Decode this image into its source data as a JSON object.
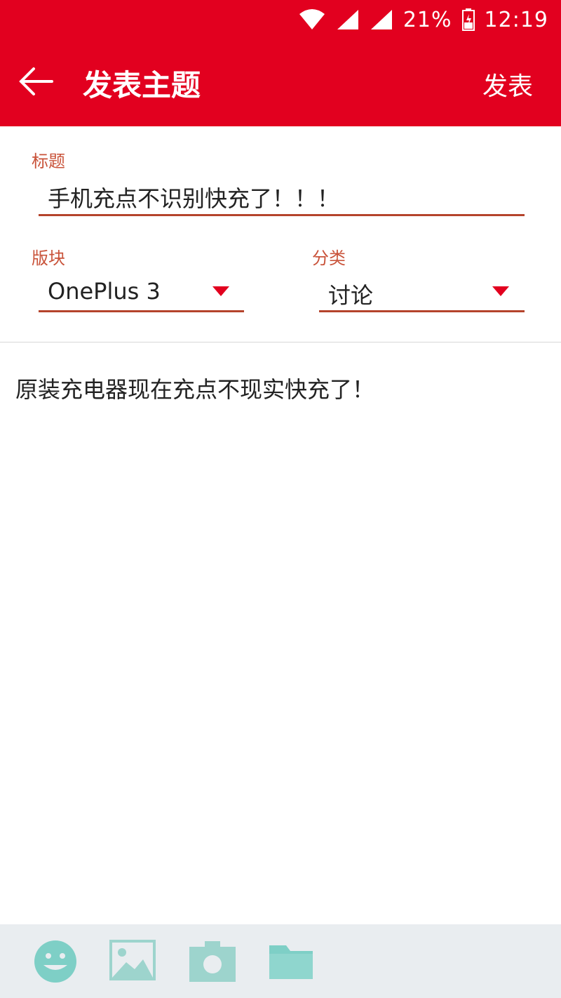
{
  "status_bar": {
    "battery": "21%",
    "time": "12:19",
    "icons": [
      "wifi-icon",
      "signal-icon",
      "signal-icon",
      "battery-icon"
    ]
  },
  "appbar": {
    "title": "发表主题",
    "publish_label": "发表",
    "back_icon": "back-arrow-icon",
    "color": "#e2001f"
  },
  "form": {
    "title_label": "标题",
    "title_value": "手机充点不识别快充了！！！",
    "board_label": "版块",
    "board_value": "OnePlus 3",
    "category_label": "分类",
    "category_value": "讨论",
    "label_color": "#c9533a",
    "accent_color": "#b5442c"
  },
  "content": {
    "body_text": "原装充电器现在充点不现实快充了！"
  },
  "toolbar": {
    "items": [
      "emoji-icon",
      "image-icon",
      "camera-icon",
      "folder-icon"
    ],
    "icon_color": "#7ecfc6"
  }
}
